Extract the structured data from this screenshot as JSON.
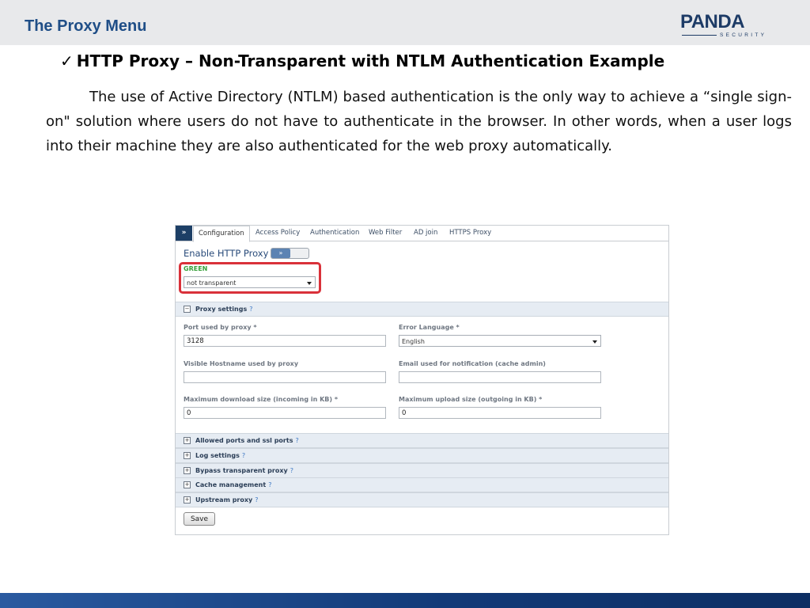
{
  "slide": {
    "title": "The Proxy Menu",
    "logo": {
      "word": "PANDA",
      "sub": "SECURITY"
    },
    "heading_check": "✓",
    "heading": "HTTP Proxy – Non-Transparent with NTLM Authentication Example",
    "paragraph": "The use of Active Directory (NTLM) based authentication is the only way to achieve a “single sign-on\" solution where users do not have to authenticate in the browser. In other words, when a user logs into their machine they are also authenticated for the web proxy automatically."
  },
  "ui": {
    "tab_arrow": "»",
    "tabs": [
      "Configuration",
      "Access Policy",
      "Authentication",
      "Web Filter",
      "AD join",
      "HTTPS Proxy"
    ],
    "enable_label": "Enable HTTP Proxy",
    "toggle_label": "»",
    "status": "GREEN",
    "mode_select": "not transparent",
    "proxy_settings": {
      "title": "Proxy settings",
      "help": "?",
      "collapse_symbol": "−",
      "port_label": "Port used by proxy *",
      "port_value": "3128",
      "error_lang_label": "Error Language *",
      "error_lang_value": "English",
      "hostname_label": "Visible Hostname used by proxy",
      "hostname_value": "",
      "email_label": "Email used for notification (cache admin)",
      "email_value": "",
      "max_download_label": "Maximum download size (incoming in KB) *",
      "max_download_value": "0",
      "max_upload_label": "Maximum upload size (outgoing in KB) *",
      "max_upload_value": "0"
    },
    "expand_symbol": "+",
    "collapsed_sections": [
      "Allowed ports and ssl ports",
      "Log settings",
      "Bypass transparent proxy",
      "Cache management",
      "Upstream proxy"
    ],
    "help": "?",
    "save_label": "Save"
  },
  "colors": {
    "title_blue": "#1f4e87",
    "status_green": "#36a13a",
    "highlight_red": "#d9313a",
    "tab_dark": "#1d3f66"
  }
}
